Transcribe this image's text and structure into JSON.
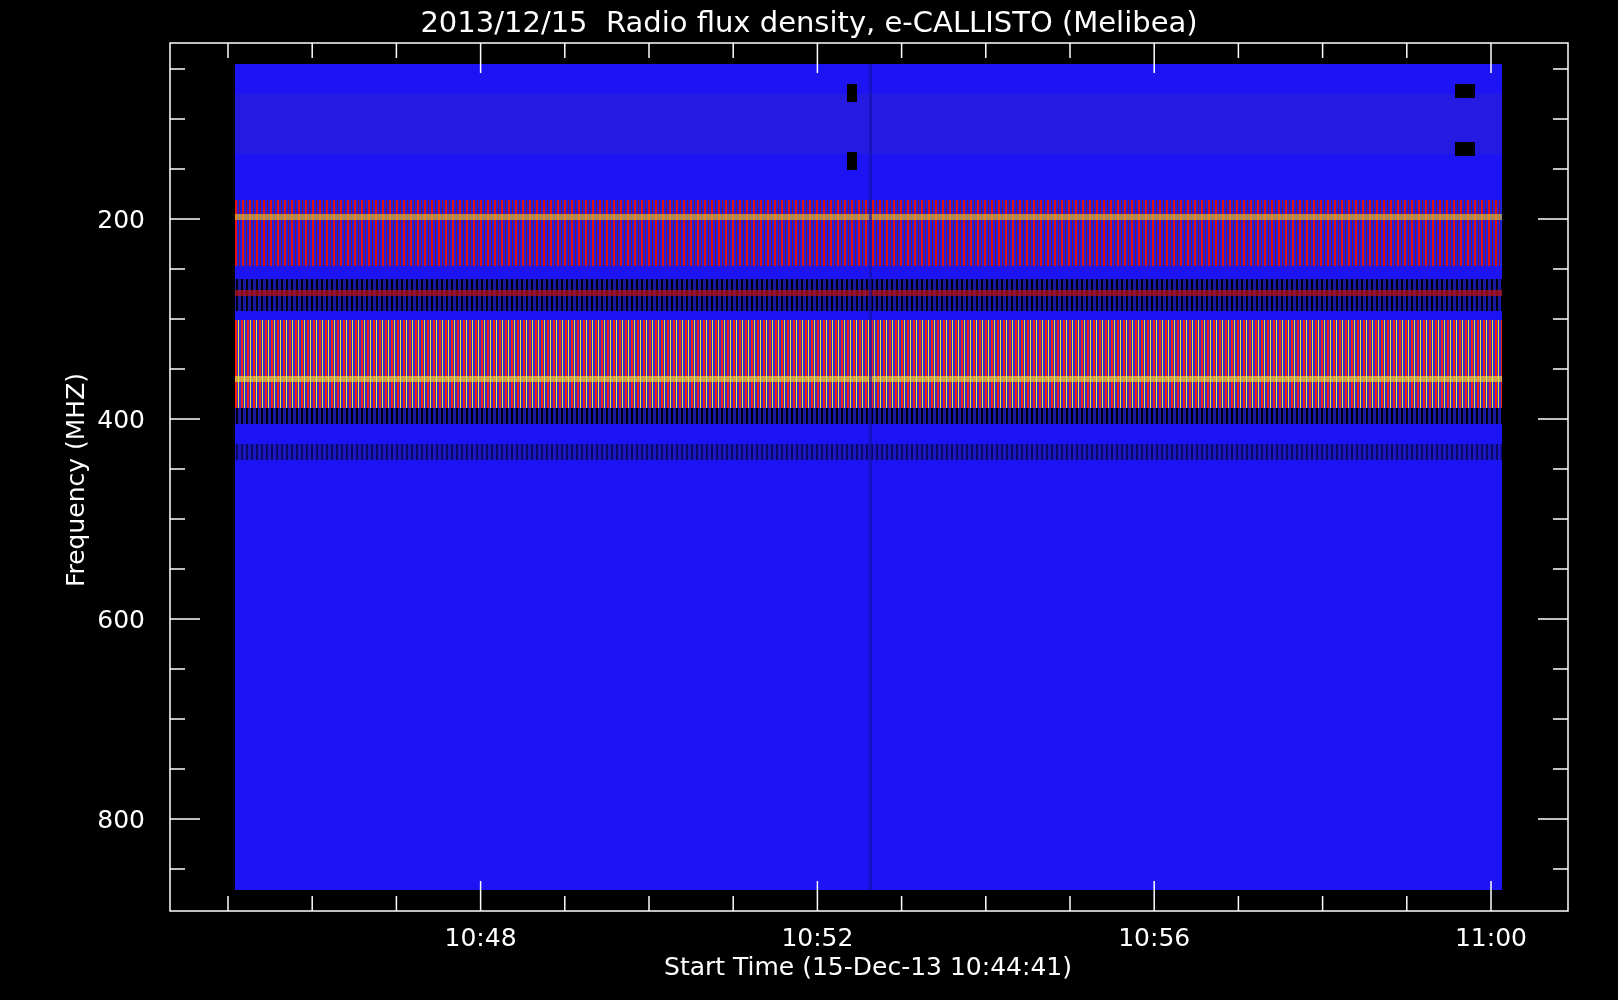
{
  "title": "2013/12/15  Radio flux density, e-CALLISTO (Melibea)",
  "y_axis": {
    "label": "Frequency (MHZ)",
    "ticks": [
      "200",
      "400",
      "600",
      "800"
    ]
  },
  "x_axis": {
    "label": "Start Time (15-Dec-13 10:44:41)",
    "ticks": [
      "10:48",
      "10:52",
      "10:56",
      "11:00"
    ]
  }
}
